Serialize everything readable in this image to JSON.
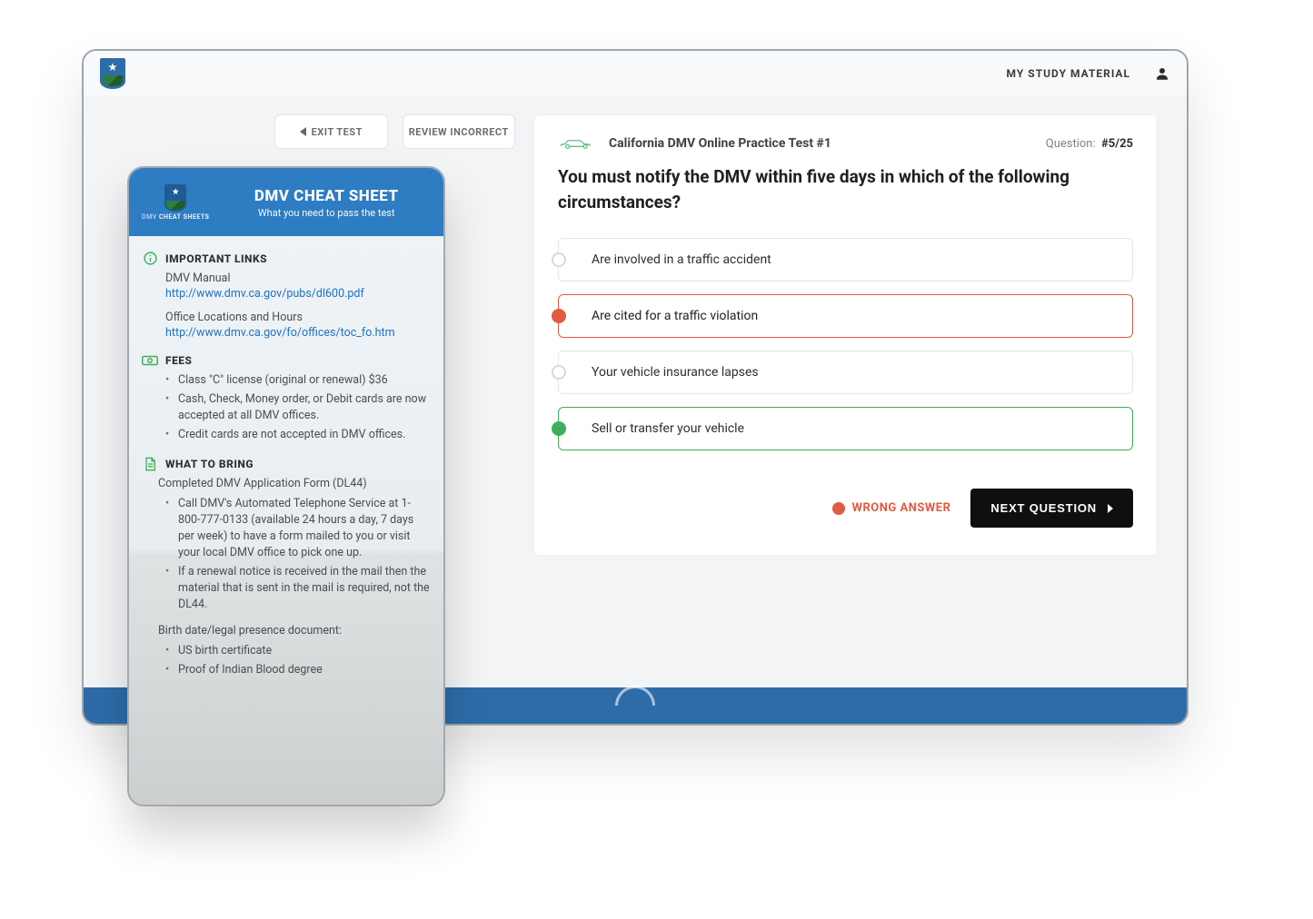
{
  "colors": {
    "accent": "#2e6ca8",
    "green": "#3fae5a",
    "red": "#e25a41",
    "ink": "#0e0f10"
  },
  "topbar": {
    "study_link": "MY STUDY MATERIAL"
  },
  "tabs": {
    "exit": "EXIT TEST",
    "review": "REVIEW INCORRECT"
  },
  "quiz": {
    "title": "California DMV Online Practice Test #1",
    "progress_label": "Question:",
    "progress_value": "#5/25",
    "question": "You must notify the DMV within five days in which of the following circumstances?",
    "answers": [
      {
        "text": "Are involved in a traffic accident",
        "state": ""
      },
      {
        "text": "Are cited for a traffic violation",
        "state": "wrong"
      },
      {
        "text": "Your vehicle insurance lapses",
        "state": ""
      },
      {
        "text": "Sell or transfer your vehicle",
        "state": "correct"
      }
    ],
    "wrong_label": "WRONG ANSWER",
    "next_label": "NEXT QUESTION"
  },
  "mobile": {
    "brand_top": "DMV",
    "brand_bottom": "CHEAT SHEETS",
    "title": "DMV CHEAT SHEET",
    "subtitle": "What you need to pass the test",
    "sections": {
      "links": {
        "heading": "IMPORTANT LINKS",
        "manual_label": "DMV Manual",
        "manual_url": "http://www.dmv.ca.gov/pubs/dl600.pdf",
        "offices_label": "Office Locations and Hours",
        "offices_url": "http://www.dmv.ca.gov/fo/offices/toc_fo.htm"
      },
      "fees": {
        "heading": "FEES",
        "items": [
          "Class \"C\" license (original or renewal) $36",
          "Cash, Check, Money order, or Debit cards are now accepted at all DMV offices.",
          "Credit cards are not accepted in DMV offices."
        ]
      },
      "bring": {
        "heading": "WHAT TO BRING",
        "intro": "Completed DMV Application Form (DL44)",
        "items": [
          "Call DMV's Automated Telephone Service at 1-800-777-0133 (available 24 hours a day, 7 days per week) to have a form mailed to you or visit your local DMV office to pick one up.",
          "If a renewal notice is received in the mail then the material that is sent in the mail is required, not the DL44."
        ],
        "birth_intro": "Birth date/legal presence document:",
        "birth_items": [
          "US birth certificate",
          "Proof of Indian Blood degree"
        ]
      }
    }
  }
}
